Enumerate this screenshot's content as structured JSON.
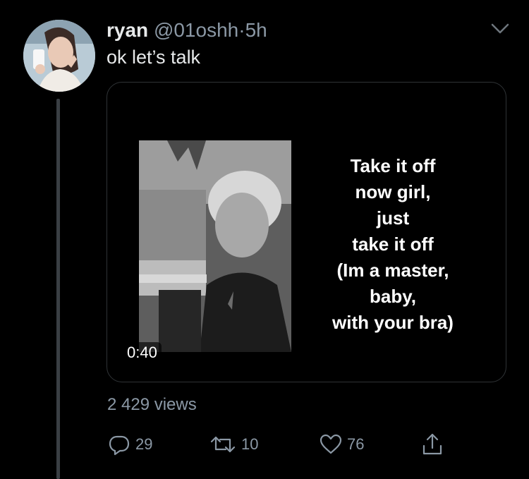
{
  "tweet": {
    "display_name": "ryan",
    "handle": "@01oshh",
    "separator": "·",
    "time": "5h",
    "text": "ok let’s talk",
    "video": {
      "caption_lines": [
        "Take it off",
        "now girl,",
        "just",
        "take it off",
        "(Im a master,",
        "baby,",
        "with your bra)"
      ],
      "duration": "0:40"
    },
    "views": "2 429 views",
    "actions": {
      "replies": "29",
      "retweets": "10",
      "likes": "76"
    }
  },
  "icons": {
    "menu": "chevron-down-icon",
    "reply": "reply-icon",
    "retweet": "retweet-icon",
    "like": "heart-icon",
    "share": "share-icon"
  },
  "colors": {
    "background": "#000000",
    "primary_text": "#e7e9ea",
    "secondary_text": "#8b98a5",
    "border": "#2f3336",
    "thread_line": "#3a3f44"
  }
}
